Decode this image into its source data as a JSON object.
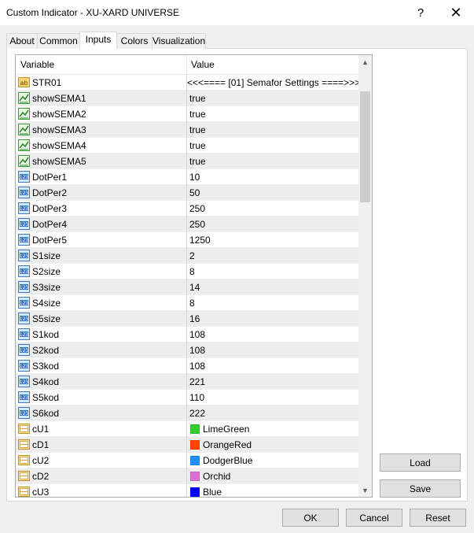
{
  "window": {
    "title": "Custom Indicator - XU-XARD UNIVERSE",
    "help_label": "?",
    "close_label": "✕"
  },
  "tabs": [
    {
      "label": "About",
      "active": false
    },
    {
      "label": "Common",
      "active": false
    },
    {
      "label": "Inputs",
      "active": true
    },
    {
      "label": "Colors",
      "active": false
    },
    {
      "label": "Visualization",
      "active": false
    }
  ],
  "grid": {
    "headers": {
      "variable": "Variable",
      "value": "Value"
    },
    "rows": [
      {
        "type": "string",
        "icon": "string-ab-icon",
        "name": "STR01",
        "value": "<<<==== [01] Semafor Settings ====>>>"
      },
      {
        "type": "bool",
        "icon": "bool-trend-icon",
        "name": "showSEMA1",
        "value": "true"
      },
      {
        "type": "bool",
        "icon": "bool-trend-icon",
        "name": "showSEMA2",
        "value": "true"
      },
      {
        "type": "bool",
        "icon": "bool-trend-icon",
        "name": "showSEMA3",
        "value": "true"
      },
      {
        "type": "bool",
        "icon": "bool-trend-icon",
        "name": "showSEMA4",
        "value": "true"
      },
      {
        "type": "bool",
        "icon": "bool-trend-icon",
        "name": "showSEMA5",
        "value": "true"
      },
      {
        "type": "int",
        "icon": "int-123-icon",
        "name": "DotPer1",
        "value": "10"
      },
      {
        "type": "int",
        "icon": "int-123-icon",
        "name": "DotPer2",
        "value": "50"
      },
      {
        "type": "int",
        "icon": "int-123-icon",
        "name": "DotPer3",
        "value": "250"
      },
      {
        "type": "int",
        "icon": "int-123-icon",
        "name": "DotPer4",
        "value": "250"
      },
      {
        "type": "int",
        "icon": "int-123-icon",
        "name": "DotPer5",
        "value": "1250"
      },
      {
        "type": "int",
        "icon": "int-123-icon",
        "name": "S1size",
        "value": "2"
      },
      {
        "type": "int",
        "icon": "int-123-icon",
        "name": "S2size",
        "value": "8"
      },
      {
        "type": "int",
        "icon": "int-123-icon",
        "name": "S3size",
        "value": "14"
      },
      {
        "type": "int",
        "icon": "int-123-icon",
        "name": "S4size",
        "value": "8"
      },
      {
        "type": "int",
        "icon": "int-123-icon",
        "name": "S5size",
        "value": "16"
      },
      {
        "type": "int",
        "icon": "int-123-icon",
        "name": "S1kod",
        "value": "108"
      },
      {
        "type": "int",
        "icon": "int-123-icon",
        "name": "S2kod",
        "value": "108"
      },
      {
        "type": "int",
        "icon": "int-123-icon",
        "name": "S3kod",
        "value": "108"
      },
      {
        "type": "int",
        "icon": "int-123-icon",
        "name": "S4kod",
        "value": "221"
      },
      {
        "type": "int",
        "icon": "int-123-icon",
        "name": "S5kod",
        "value": "110"
      },
      {
        "type": "int",
        "icon": "int-123-icon",
        "name": "S6kod",
        "value": "222"
      },
      {
        "type": "color",
        "icon": "color-palette-icon",
        "name": "cU1",
        "value": "LimeGreen",
        "color": "#32cd32"
      },
      {
        "type": "color",
        "icon": "color-palette-icon",
        "name": "cD1",
        "value": "OrangeRed",
        "color": "#ff4500"
      },
      {
        "type": "color",
        "icon": "color-palette-icon",
        "name": "cU2",
        "value": "DodgerBlue",
        "color": "#1e90ff"
      },
      {
        "type": "color",
        "icon": "color-palette-icon",
        "name": "cD2",
        "value": "Orchid",
        "color": "#da70d6"
      },
      {
        "type": "color",
        "icon": "color-palette-icon",
        "name": "cU3",
        "value": "Blue",
        "color": "#0000ff"
      }
    ]
  },
  "buttons": {
    "load": "Load",
    "save": "Save",
    "ok": "OK",
    "cancel": "Cancel",
    "reset": "Reset"
  },
  "colors": {
    "window_bg": "#f0f0f0",
    "row_alt": "#ededed",
    "button_bg": "#e1e1e1"
  }
}
